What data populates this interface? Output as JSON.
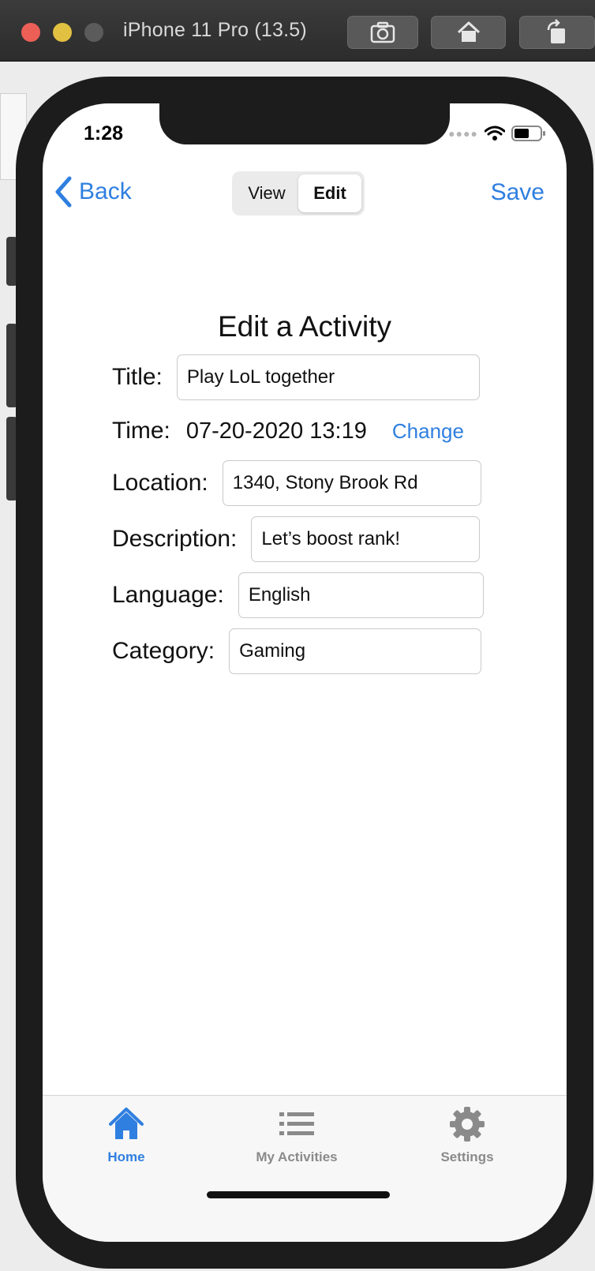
{
  "simulator": {
    "title": "iPhone 11 Pro (13.5)"
  },
  "status": {
    "time": "1:28"
  },
  "nav": {
    "back_label": "Back",
    "segments": [
      "View",
      "Edit"
    ],
    "active_segment": "Edit",
    "save_label": "Save"
  },
  "form": {
    "heading": "Edit a Activity",
    "title_label": "Title:",
    "title_value": "Play LoL together",
    "time_label": "Time:",
    "time_value": "07-20-2020 13:19",
    "change_label": "Change",
    "location_label": "Location:",
    "location_value": "1340, Stony Brook Rd",
    "description_label": "Description:",
    "description_value": "Let’s boost rank!",
    "language_label": "Language:",
    "language_value": "English",
    "category_label": "Category:",
    "category_value": "Gaming"
  },
  "tabs": [
    {
      "label": "Home",
      "icon": "home-icon",
      "active": true
    },
    {
      "label": "My Activities",
      "icon": "list-icon",
      "active": false
    },
    {
      "label": "Settings",
      "icon": "gear-icon",
      "active": false
    }
  ],
  "colors": {
    "accent": "#2f7fe0",
    "inactive": "#8a8a8a"
  }
}
